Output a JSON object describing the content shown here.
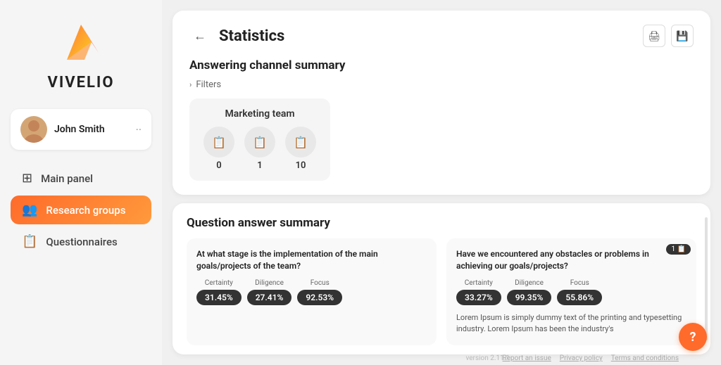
{
  "app": {
    "logo_text": "VIVELIO",
    "version": "version 2.11.1"
  },
  "user": {
    "name": "John Smith",
    "menu_dots": "··"
  },
  "nav": {
    "items": [
      {
        "id": "main-panel",
        "label": "Main panel",
        "icon": "grid",
        "active": false
      },
      {
        "id": "research-groups",
        "label": "Research groups",
        "icon": "users",
        "active": true
      },
      {
        "id": "questionnaires",
        "label": "Questionnaires",
        "icon": "list",
        "active": false
      }
    ]
  },
  "stats_page": {
    "back_label": "←",
    "title": "Statistics",
    "print_icon": "🖨",
    "download_icon": "💾"
  },
  "answering_channel": {
    "section_title": "Answering channel summary",
    "filters_label": "Filters",
    "marketing_team": {
      "label": "Marketing team",
      "icons": [
        {
          "icon": "📋",
          "count": "0"
        },
        {
          "icon": "📋",
          "count": "1"
        },
        {
          "icon": "📋",
          "count": "10"
        }
      ]
    }
  },
  "question_answer": {
    "section_title": "Question answer summary",
    "cards": [
      {
        "question": "At what stage is the implementation of the main goals/projects of the team?",
        "badge": null,
        "stats": [
          {
            "label": "Certainty",
            "value": "31.45%"
          },
          {
            "label": "Diligence",
            "value": "27.41%"
          },
          {
            "label": "Focus",
            "value": "92.53%"
          }
        ],
        "body_text": null
      },
      {
        "question": "Have we encountered any obstacles or problems in achieving our goals/projects?",
        "badge": "1",
        "stats": [
          {
            "label": "Certainty",
            "value": "33.27%"
          },
          {
            "label": "Diligence",
            "value": "99.35%"
          },
          {
            "label": "Focus",
            "value": "55.86%"
          }
        ],
        "body_text": "Lorem Ipsum is simply dummy text of the printing and typesetting industry. Lorem Ipsum has been the industry's"
      }
    ]
  },
  "footer": {
    "report_issue": "Report an issue",
    "privacy_policy": "Privacy policy",
    "terms": "Terms and conditions",
    "version": "version 2.11.1"
  },
  "help": {
    "label": "?"
  }
}
